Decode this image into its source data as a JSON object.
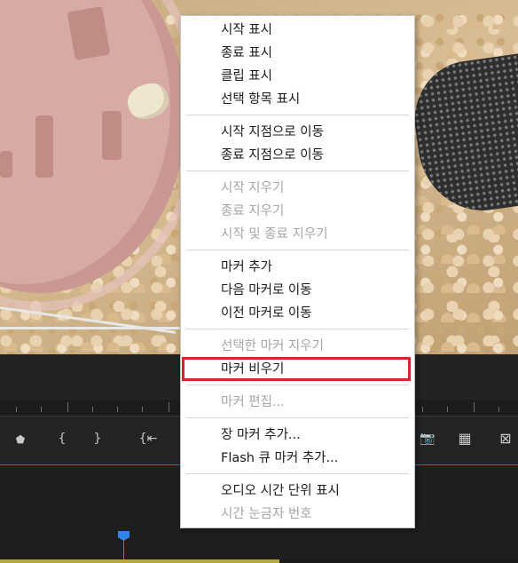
{
  "context_menu": {
    "items": [
      {
        "label": "시작 표시",
        "enabled": true
      },
      {
        "label": "종료 표시",
        "enabled": true
      },
      {
        "label": "클립 표시",
        "enabled": true
      },
      {
        "label": "선택 항목 표시",
        "enabled": true
      },
      {
        "label": "시작 지점으로 이동",
        "enabled": true
      },
      {
        "label": "종료 지점으로 이동",
        "enabled": true
      },
      {
        "label": "시작 지우기",
        "enabled": false
      },
      {
        "label": "종료 지우기",
        "enabled": false
      },
      {
        "label": "시작 및 종료 지우기",
        "enabled": false
      },
      {
        "label": "마커 추가",
        "enabled": true
      },
      {
        "label": "다음 마커로 이동",
        "enabled": true
      },
      {
        "label": "이전 마커로 이동",
        "enabled": true
      },
      {
        "label": "선택한 마커 지우기",
        "enabled": false
      },
      {
        "label": "마커 비우기",
        "enabled": true,
        "highlighted": true
      },
      {
        "label": "마커 편집...",
        "enabled": false
      },
      {
        "label": "장 마커 추가...",
        "enabled": true
      },
      {
        "label": "Flash 큐 마커 추가...",
        "enabled": true
      },
      {
        "label": "오디오 시간 단위 표시",
        "enabled": true
      },
      {
        "label": "시간 눈금자 번호",
        "enabled": false
      }
    ]
  },
  "toolbar": {
    "left_tools": [
      {
        "name": "add-marker-icon",
        "glyph": "⬟"
      },
      {
        "name": "mark-in-icon",
        "glyph": "{"
      },
      {
        "name": "mark-out-icon",
        "glyph": "}"
      },
      {
        "name": "go-to-in-icon",
        "glyph": "{⇤"
      }
    ],
    "right_tools": [
      {
        "name": "export-frame-icon",
        "glyph": "📷"
      },
      {
        "name": "insert-icon",
        "glyph": "▦"
      },
      {
        "name": "compare-view-icon",
        "glyph": "⊠"
      }
    ]
  },
  "colors": {
    "highlight_border": "#d9242b",
    "playhead": "#2f86e8",
    "panel": "#232323"
  }
}
